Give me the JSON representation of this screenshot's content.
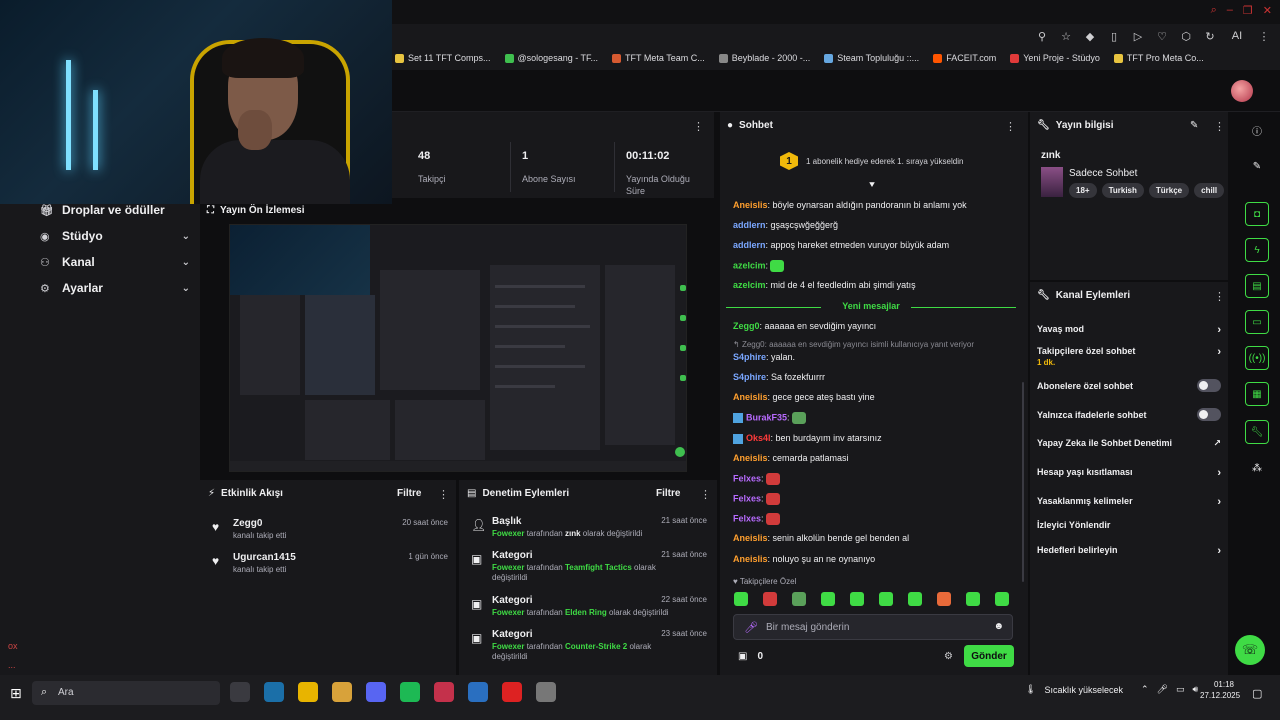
{
  "bookmarks": [
    {
      "label": "Set 11 TFT Comps...",
      "color": "#e8c440"
    },
    {
      "label": "@sologesang - TF...",
      "color": "#3fbf4f"
    },
    {
      "label": "TFT Meta Team C...",
      "color": "#d65a31"
    },
    {
      "label": "Beyblade - 2000 -...",
      "color": "#888888"
    },
    {
      "label": "Steam Topluluğu ::...",
      "color": "#66a7e0"
    },
    {
      "label": "FACEIT.com",
      "color": "#ff5500"
    },
    {
      "label": "Yeni Proje - Stüdyo",
      "color": "#e03a3a"
    },
    {
      "label": "TFT Pro Meta Co...",
      "color": "#e8c440"
    }
  ],
  "toolbar": {
    "ai_label": "AI"
  },
  "nav": {
    "items": [
      {
        "label": "Droplar ve ödüller",
        "icon": "gift-icon"
      },
      {
        "label": "Stüdyo",
        "icon": "camera-icon"
      },
      {
        "label": "Kanal",
        "icon": "channel-icon"
      },
      {
        "label": "Ayarlar",
        "icon": "gear-icon"
      }
    ],
    "side_marks": [
      "ox",
      "..."
    ]
  },
  "stats": [
    {
      "value": "48",
      "label": "Takipçi"
    },
    {
      "value": "1",
      "label": "Abone Sayısı"
    },
    {
      "value": "00:11:02",
      "label": "Yayında Olduğu Süre"
    }
  ],
  "preview": {
    "title": "Yayın Ön İzlemesi"
  },
  "activity": {
    "title": "Etkinlik Akışı",
    "filter": "Filtre",
    "items": [
      {
        "name": "Zegg0",
        "sub": "kanalı takip etti",
        "time": "20 saat önce"
      },
      {
        "name": "Ugurcan1415",
        "sub": "kanalı takip etti",
        "time": "1 gün önce"
      }
    ]
  },
  "moderation": {
    "title": "Denetim Eylemleri",
    "filter": "Filtre",
    "items": [
      {
        "title": "Başlık",
        "user": "Fowexer",
        "mid": "tarafından",
        "value": "zınk",
        "tail": "olarak değiştirildi",
        "time": "21 saat önce",
        "icon": "user-edit-icon"
      },
      {
        "title": "Kategori",
        "user": "Fowexer",
        "mid": "tarafından",
        "value": "Teamfight Tactics",
        "tail": "olarak değiştirildi",
        "time": "21 saat önce",
        "icon": "category-icon"
      },
      {
        "title": "Kategori",
        "user": "Fowexer",
        "mid": "tarafından",
        "value": "Elden Ring",
        "tail": "olarak değiştirildi",
        "time": "22 saat önce",
        "icon": "category-icon"
      },
      {
        "title": "Kategori",
        "user": "Fowexer",
        "mid": "tarafından",
        "value": "Counter-Strike 2",
        "tail": "olarak değiştirildi",
        "time": "23 saat önce",
        "icon": "category-icon"
      }
    ]
  },
  "chat": {
    "title": "Sohbet",
    "gift_banner": "1 abonelik hediye ederek 1. sıraya yükseldin",
    "gift_rank": "1",
    "new_messages": "Yeni mesajlar",
    "followers_only": "Takipçilere Özel",
    "placeholder": "Bir mesaj gönderin",
    "points": "0",
    "send": "Gönder",
    "messages": [
      {
        "user": "Aneislis",
        "color": "#ff9f2e",
        "text": ": böyle oynarsan aldığın pandoranın bi anlamı yok"
      },
      {
        "user": "addlern",
        "color": "#7aa7ff",
        "text": ": gşaşcşwğeğğerğ"
      },
      {
        "user": "addlern",
        "color": "#7aa7ff",
        "text": ": appoş hareket etmeden vuruyor büyük adam"
      },
      {
        "user": "azelcim",
        "color": "#3fdb45",
        "text": ":",
        "emote": "#3fdb45"
      },
      {
        "user": "azelcim",
        "color": "#3fdb45",
        "text": ": mid de 4 el feedledim abi şimdi yatış"
      },
      {
        "user": "Zegg0",
        "color": "#3fdb45",
        "text": ": aaaaaa en sevdiğim yayıncı"
      },
      {
        "user": "S4phire",
        "color": "#7aa7ff",
        "text": ": yalan.",
        "reply": "Zegg0: aaaaaa en sevdiğim yayıncı isimli kullanıcıya yanıt veriyor"
      },
      {
        "user": "S4phire",
        "color": "#7aa7ff",
        "text": ": Sa fozekfuırrr"
      },
      {
        "user": "Aneislis",
        "color": "#ff9f2e",
        "text": ": gece gece ateş bastı yine"
      },
      {
        "user": "BurakF35",
        "color": "#b86bff",
        "text": ":",
        "emote": "#5aa05a"
      },
      {
        "user": "Oks4l",
        "color": "#ff3b3b",
        "text": ": ben burdayım inv atarsınız"
      },
      {
        "user": "Aneislis",
        "color": "#ff9f2e",
        "text": ": cemarda patlamasi"
      },
      {
        "user": "Felxes",
        "color": "#b86bff",
        "text": ":",
        "emote": "#d23b3b"
      },
      {
        "user": "Felxes",
        "color": "#b86bff",
        "text": ":",
        "emote": "#d23b3b"
      },
      {
        "user": "Felxes",
        "color": "#b86bff",
        "text": ":",
        "emote": "#d23b3b"
      },
      {
        "user": "Aneislis",
        "color": "#ff9f2e",
        "text": ": senin alkolün bende gel benden al"
      },
      {
        "user": "Aneislis",
        "color": "#ff9f2e",
        "text": ": noluyo şu an ne oynanıyo"
      }
    ],
    "emotes": [
      "#3fdb45",
      "#d23b3b",
      "#5aa05a",
      "#3fdb45",
      "#3fdb45",
      "#3fdb45",
      "#3fdb45",
      "#e86a3a",
      "#3fdb45",
      "#3fdb45"
    ]
  },
  "stream_info": {
    "title": "Yayın bilgisi",
    "stream_title": "zınk",
    "category": "Sadece Sohbet",
    "tags": [
      "18+",
      "Turkish",
      "Türkçe",
      "chill"
    ]
  },
  "channel_actions": {
    "title": "Kanal Eylemleri",
    "items": [
      {
        "label": "Yavaş mod",
        "type": "chevron"
      },
      {
        "label": "Takipçilere özel sohbet",
        "sub": "1 dk.",
        "type": "chevron"
      },
      {
        "label": "Abonelere özel sohbet",
        "type": "toggle"
      },
      {
        "label": "Yalnızca ifadelerle sohbet",
        "type": "toggle"
      },
      {
        "label": "Yapay Zeka ile Sohbet Denetimi",
        "type": "external"
      },
      {
        "label": "Hesap yaşı kısıtlaması",
        "type": "chevron"
      },
      {
        "label": "Yasaklanmış kelimeler",
        "type": "chevron"
      },
      {
        "label": "İzleyici Yönlendir",
        "type": "none"
      },
      {
        "label": "Hedefleri belirleyin",
        "type": "chevron"
      }
    ]
  },
  "taskbar": {
    "search": "Ara",
    "weather": "Sıcaklık yükselecek",
    "time": "01:18",
    "date": "27.12.2025",
    "apps": [
      "#3a3a40",
      "#1b6fa8",
      "#e8b400",
      "#d8a23a",
      "#5865f2",
      "#1db954",
      "#c4314b",
      "#2a6fc0",
      "#d22",
      "#777"
    ]
  }
}
